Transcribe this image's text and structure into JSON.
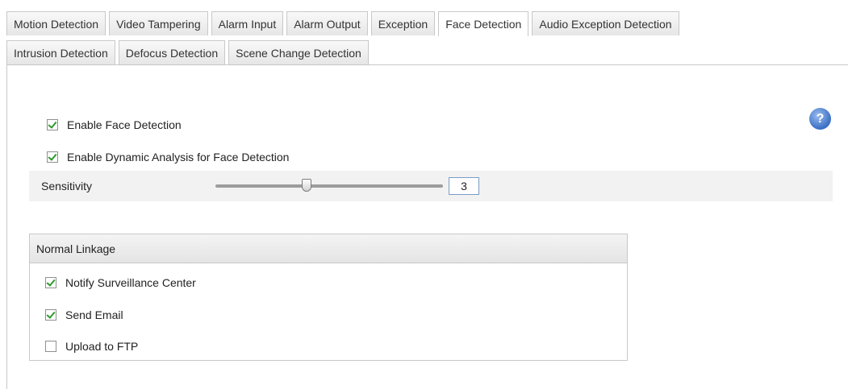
{
  "tabs_row1": [
    {
      "label": "Motion Detection",
      "active": false
    },
    {
      "label": "Video Tampering",
      "active": false
    },
    {
      "label": "Alarm Input",
      "active": false
    },
    {
      "label": "Alarm Output",
      "active": false
    },
    {
      "label": "Exception",
      "active": false
    },
    {
      "label": "Face Detection",
      "active": true
    },
    {
      "label": "Audio Exception Detection",
      "active": false
    }
  ],
  "tabs_row2": [
    {
      "label": "Intrusion Detection",
      "active": false
    },
    {
      "label": "Defocus Detection",
      "active": false
    },
    {
      "label": "Scene Change Detection",
      "active": false
    }
  ],
  "enable_face_detection": {
    "label": "Enable Face Detection",
    "checked": true
  },
  "enable_dynamic_analysis": {
    "label": "Enable Dynamic Analysis for Face Detection",
    "checked": true
  },
  "help_icon": "question-mark-icon",
  "help_glyph": "?",
  "sensitivity": {
    "label": "Sensitivity",
    "value": "3",
    "min": 1,
    "max": 6
  },
  "linkage": {
    "title": "Normal Linkage",
    "items": [
      {
        "label": "Notify Surveillance Center",
        "checked": true
      },
      {
        "label": "Send Email",
        "checked": true
      },
      {
        "label": "Upload to FTP",
        "checked": false
      }
    ]
  },
  "colors": {
    "check_green": "#2b9a2b",
    "help_blue": "#3a6fc4",
    "panel_grey": "#f2f2f2"
  }
}
